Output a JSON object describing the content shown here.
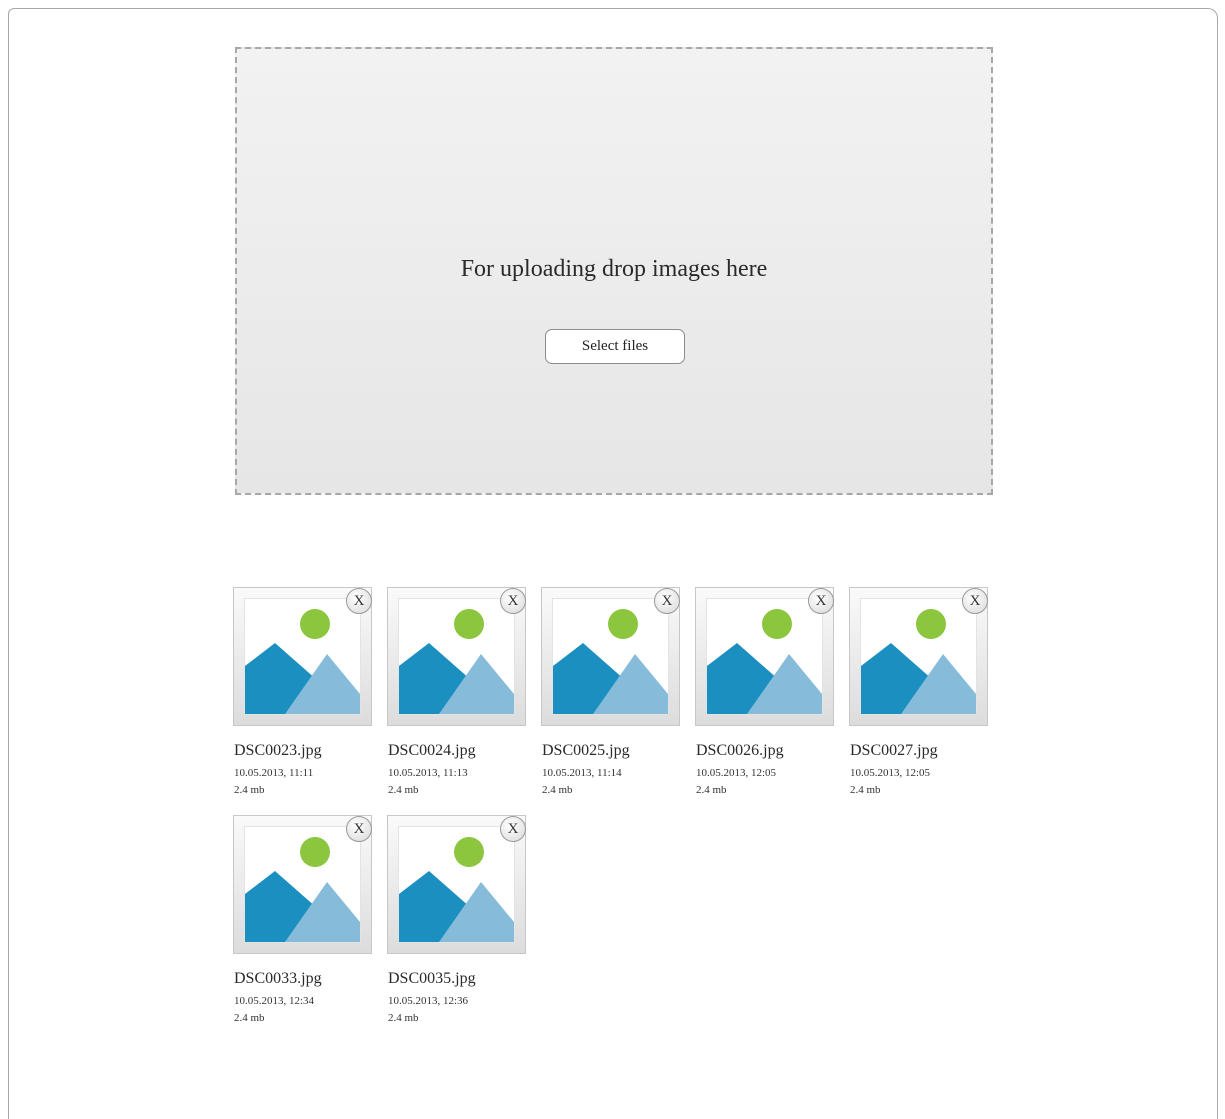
{
  "upload": {
    "drop_text": "For uploading drop images here",
    "select_files_label": "Select files"
  },
  "files": [
    {
      "name": "DSC0023.jpg",
      "date": "10.05.2013, 11:11",
      "size": "2.4 mb",
      "remove_label": "X",
      "thumb_icon": "image-placeholder-icon"
    },
    {
      "name": "DSC0024.jpg",
      "date": "10.05.2013, 11:13",
      "size": "2.4 mb",
      "remove_label": "X",
      "thumb_icon": "image-placeholder-icon"
    },
    {
      "name": "DSC0025.jpg",
      "date": "10.05.2013, 11:14",
      "size": "2.4 mb",
      "remove_label": "X",
      "thumb_icon": "image-placeholder-icon"
    },
    {
      "name": "DSC0026.jpg",
      "date": "10.05.2013, 12:05",
      "size": "2.4 mb",
      "remove_label": "X",
      "thumb_icon": "image-placeholder-icon"
    },
    {
      "name": "DSC0027.jpg",
      "date": "10.05.2013, 12:05",
      "size": "2.4 mb",
      "remove_label": "X",
      "thumb_icon": "image-placeholder-icon"
    },
    {
      "name": "DSC0033.jpg",
      "date": "10.05.2013, 12:34",
      "size": "2.4 mb",
      "remove_label": "X",
      "thumb_icon": "image-placeholder-icon"
    },
    {
      "name": "DSC0035.jpg",
      "date": "10.05.2013, 12:36",
      "size": "2.4 mb",
      "remove_label": "X",
      "thumb_icon": "image-placeholder-icon"
    }
  ],
  "colors": {
    "mountain_dark": "#1b8fc0",
    "mountain_light": "#86bcd9",
    "sun": "#8cc63f",
    "dropzone_border": "#a7a7a7"
  }
}
